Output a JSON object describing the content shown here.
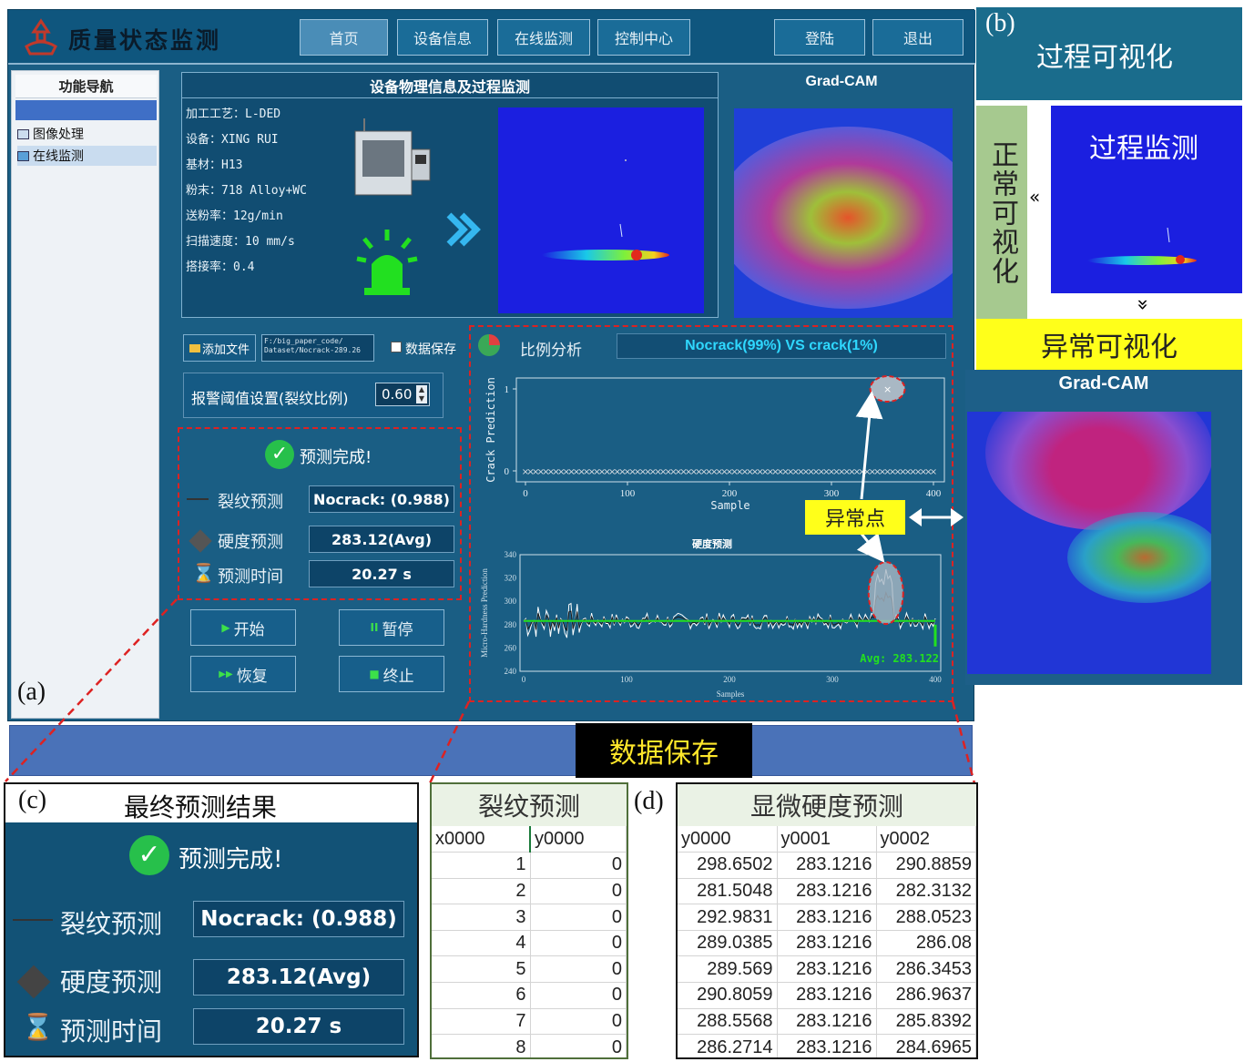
{
  "app": {
    "title": "质量状态监测",
    "nav": [
      "首页",
      "设备信息",
      "在线监测",
      "控制中心"
    ],
    "login": "登陆",
    "logout": "退出",
    "sidebar": {
      "header": "功能导航",
      "items": [
        "图像处理",
        "在线监测"
      ]
    },
    "device_panel": {
      "title": "设备物理信息及过程监测",
      "info": [
        "加工工艺：L-DED",
        "设备：XING RUI",
        "基材：H13",
        "粉末：718 Alloy+WC",
        "送粉率：12g/min",
        "扫描速度：10 mm/s",
        "搭接率：0.4"
      ]
    },
    "gradcam_label": "Grad-CAM",
    "file": {
      "add_button": "添加文件",
      "path": "F:/big_paper_code/ Dataset/Nocrack-289.26",
      "save_label": "数据保存"
    },
    "threshold": {
      "label": "报警阈值设置(裂纹比例)",
      "value": "0.60"
    },
    "result": {
      "status": "预测完成!",
      "crack_label": "裂纹预测",
      "crack_value": "Nocrack: (0.988)",
      "hardness_label": "硬度预测",
      "hardness_value": "283.12(Avg)",
      "time_label": "预测时间",
      "time_value": "20.27 s"
    },
    "controls": {
      "start": "开始",
      "pause": "暂停",
      "resume": "恢复",
      "stop": "终止"
    },
    "ratio": {
      "label": "比例分析",
      "value": "Nocrack(99%) VS crack(1%)"
    },
    "anomaly_label": "异常点",
    "panel_label": "(a)"
  },
  "panel_b": {
    "label": "(b)",
    "title": "过程可视化",
    "normal_label": "正常可视化",
    "monitor_label": "过程监测",
    "abnormal_label": "异常可视化",
    "gradcam_label": "Grad-CAM"
  },
  "save_banner": "数据保存",
  "panel_c": {
    "label": "(c)",
    "title": "最终预测结果",
    "status": "预测完成!",
    "crack_label": "裂纹预测",
    "crack_value": "Nocrack: (0.988)",
    "hardness_label": "硬度预测",
    "hardness_value": "283.12(Avg)",
    "time_label": "预测时间",
    "time_value": "20.27 s"
  },
  "crack_table": {
    "title": "裂纹预测",
    "headers": [
      "x0000",
      "y0000"
    ],
    "rows": [
      [
        "1",
        "0"
      ],
      [
        "2",
        "0"
      ],
      [
        "3",
        "0"
      ],
      [
        "4",
        "0"
      ],
      [
        "5",
        "0"
      ],
      [
        "6",
        "0"
      ],
      [
        "7",
        "0"
      ],
      [
        "8",
        "0"
      ]
    ]
  },
  "panel_d": {
    "label": "(d)",
    "title": "显微硬度预测",
    "headers": [
      "y0000",
      "y0001",
      "y0002"
    ],
    "rows": [
      [
        "298.6502",
        "283.1216",
        "290.8859"
      ],
      [
        "281.5048",
        "283.1216",
        "282.3132"
      ],
      [
        "292.9831",
        "283.1216",
        "288.0523"
      ],
      [
        "289.0385",
        "283.1216",
        "286.08"
      ],
      [
        "289.569",
        "283.1216",
        "286.3453"
      ],
      [
        "290.8059",
        "283.1216",
        "286.9637"
      ],
      [
        "288.5568",
        "283.1216",
        "285.8392"
      ],
      [
        "286.2714",
        "283.1216",
        "284.6965"
      ]
    ]
  },
  "chart_data": [
    {
      "type": "scatter",
      "xlabel": "Sample",
      "ylabel": "Crack Prediction",
      "xlim": [
        0,
        400
      ],
      "ylim": [
        0,
        1
      ],
      "xticks": [
        "0",
        "100",
        "200",
        "300",
        "400"
      ],
      "yticks": [
        "0",
        "1"
      ],
      "series": [
        {
          "x": [
            0,
            400
          ],
          "y": [
            0,
            0
          ]
        },
        {
          "x": [
            355
          ],
          "y": [
            1
          ]
        }
      ],
      "grid": false
    },
    {
      "type": "line",
      "title": "硬度预测",
      "xlabel": "Samples",
      "ylabel": "Micro-Hardness Prediction",
      "xlim": [
        0,
        400
      ],
      "ylim": [
        240,
        340
      ],
      "xticks": [
        "0",
        "100",
        "200",
        "300",
        "400"
      ],
      "yticks": [
        "240",
        "260",
        "280",
        "300",
        "320",
        "340"
      ],
      "annotation": "Avg: 283.122",
      "mean": 283.122,
      "grid": false
    }
  ]
}
